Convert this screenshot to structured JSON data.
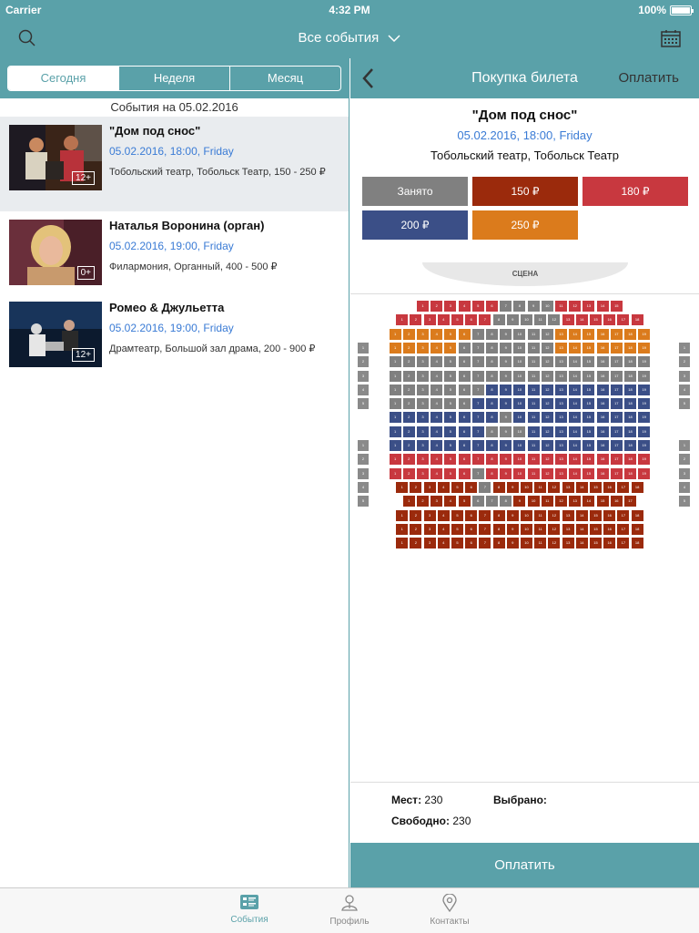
{
  "status": {
    "carrier": "Carrier",
    "time": "4:32 PM",
    "battery": "100%"
  },
  "header": {
    "title": "Все события"
  },
  "tabs": [
    "Сегодня",
    "Неделя",
    "Месяц"
  ],
  "events_header": "События на 05.02.2016",
  "events": [
    {
      "title": "\"Дом под снос\"",
      "date": "05.02.2016, 18:00, Friday",
      "place": "Тобольский театр, Тобольск Театр, 150 - 250 ₽",
      "age": "12+",
      "selected": true
    },
    {
      "title": "Наталья Воронина (орган)",
      "date": "05.02.2016, 19:00, Friday",
      "place": "Филармония, Органный, 400 - 500 ₽",
      "age": "0+",
      "selected": false
    },
    {
      "title": "Ромео & Джульетта",
      "date": "05.02.2016, 19:00, Friday",
      "place": "Драмтеатр, Большой зал драма, 200 - 900 ₽",
      "age": "12+",
      "selected": false
    }
  ],
  "purchase": {
    "title": "Покупка билета",
    "pay_label": "Оплатить",
    "event_title": "\"Дом под снос\"",
    "event_date": "05.02.2016, 18:00, Friday",
    "event_place": "Тобольский театр, Тобольск Театр",
    "legend": [
      {
        "label": "Занято",
        "color": "#808080"
      },
      {
        "label": "150 ₽",
        "color": "#9b2a0c"
      },
      {
        "label": "180 ₽",
        "color": "#c8383f"
      },
      {
        "label": "200 ₽",
        "color": "#3b4f87"
      },
      {
        "label": "250 ₽",
        "color": "#db7b1c"
      }
    ],
    "stage": "СЦЕНА",
    "seats_label": "Мест:",
    "seats_value": "230",
    "selected_label": "Выбрано:",
    "free_label": "Свободно:",
    "free_value": "230",
    "pay_button": "Оплатить"
  },
  "tabbar": [
    {
      "label": "События",
      "icon": "events-icon",
      "active": true
    },
    {
      "label": "Профиль",
      "icon": "profile-icon",
      "active": false
    },
    {
      "label": "Контакты",
      "icon": "location-pin-icon",
      "active": false
    }
  ]
}
